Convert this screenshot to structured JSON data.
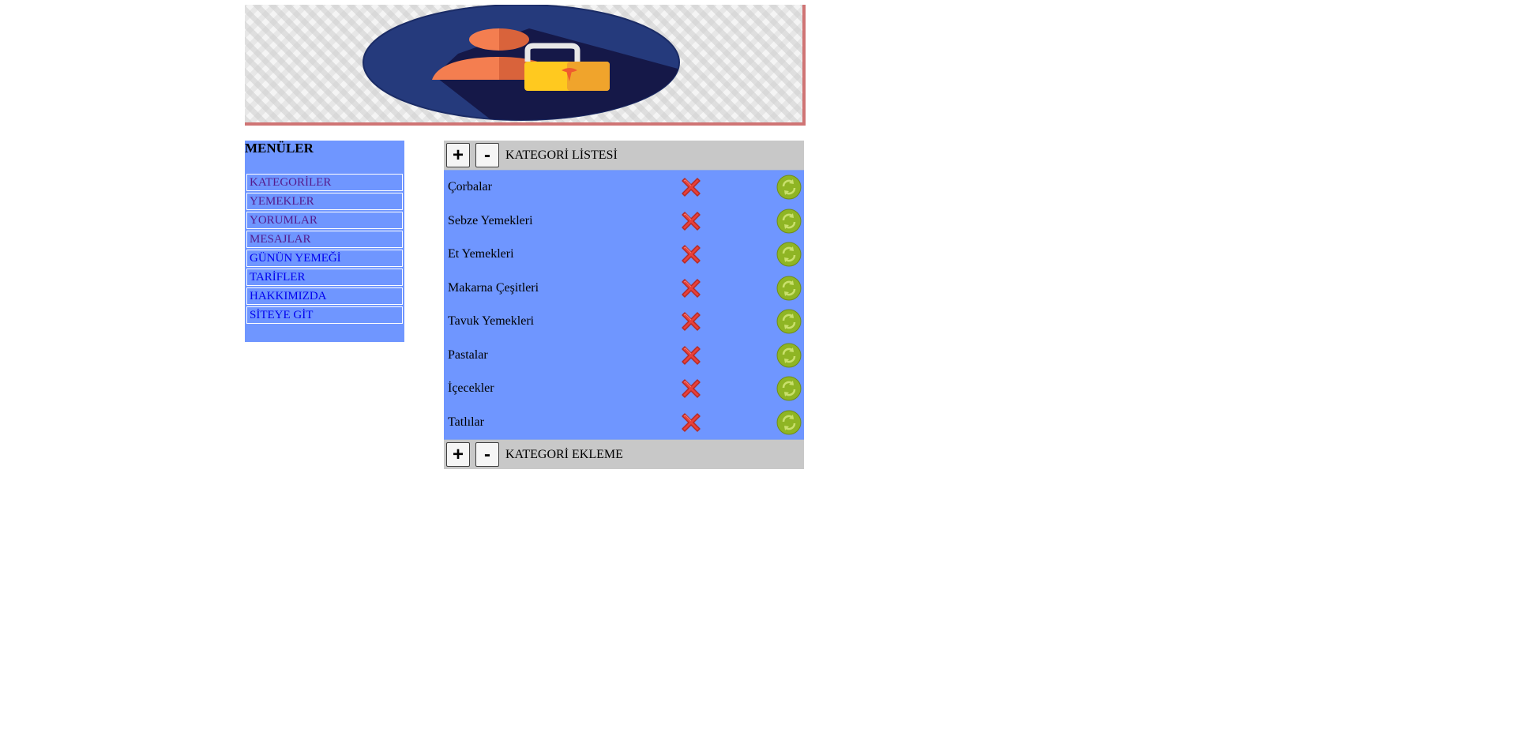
{
  "banner": {
    "logo_icon": "user-lock-icon"
  },
  "sidebar": {
    "title": "MENÜLER",
    "items": [
      {
        "label": "KATEGORİLER",
        "state": "visited"
      },
      {
        "label": "YEMEKLER",
        "state": "visited"
      },
      {
        "label": "YORUMLAR",
        "state": "visited"
      },
      {
        "label": "MESAJLAR",
        "state": "visited"
      },
      {
        "label": "GÜNÜN YEMEĞİ",
        "state": "unvisited"
      },
      {
        "label": "TARİFLER",
        "state": "unvisited"
      },
      {
        "label": "HAKKIMIZDA",
        "state": "unvisited"
      },
      {
        "label": "SİTEYE GİT",
        "state": "unvisited"
      }
    ]
  },
  "category_list": {
    "expand_label": "+",
    "collapse_label": "-",
    "title": "KATEGORİ LİSTESİ",
    "rows": [
      {
        "name": "Çorbalar"
      },
      {
        "name": "Sebze Yemekleri"
      },
      {
        "name": "Et Yemekleri"
      },
      {
        "name": "Makarna Çeşitleri"
      },
      {
        "name": "Tavuk Yemekleri"
      },
      {
        "name": "Pastalar"
      },
      {
        "name": "İçecekler"
      },
      {
        "name": "Tatlılar"
      }
    ],
    "delete_icon": "red-x-delete-icon",
    "update_icon": "green-refresh-icon"
  },
  "category_add": {
    "expand_label": "+",
    "collapse_label": "-",
    "title": "KATEGORİ EKLEME"
  },
  "colors": {
    "panel_blue": "#6f96ff",
    "header_gray": "#c8c8c8",
    "banner_border": "#cf7474",
    "visited_link": "#551a8b",
    "unvisited_link": "#0000ee"
  }
}
